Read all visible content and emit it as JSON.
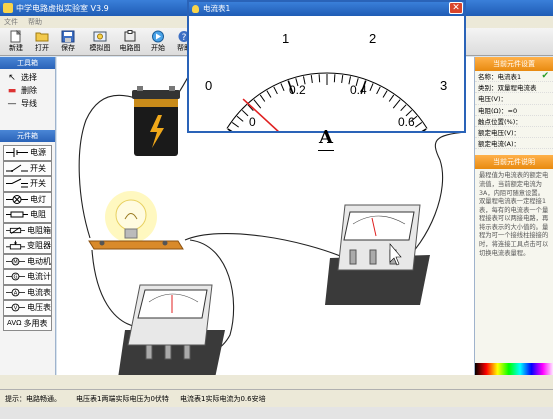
{
  "window": {
    "title": "中学电路虚拟实验室 V3.9"
  },
  "menu": [
    "文件",
    "帮助"
  ],
  "toolbar": [
    {
      "label": "新建",
      "icon": "new-icon"
    },
    {
      "label": "打开",
      "icon": "open-folder-icon"
    },
    {
      "label": "保存",
      "icon": "save-icon"
    },
    {
      "label": "模拟图",
      "icon": "simulation-icon"
    },
    {
      "label": "电路图",
      "icon": "circuit-diagram-icon"
    },
    {
      "label": "开始",
      "icon": "start-icon"
    },
    {
      "label": "帮助",
      "icon": "help-icon"
    }
  ],
  "toolbox": {
    "header": "工具箱",
    "tools": [
      {
        "label": "选择",
        "icon": "cursor-icon"
      },
      {
        "label": "删除",
        "icon": "eraser-icon"
      },
      {
        "label": "导线",
        "icon": "wire-icon"
      }
    ]
  },
  "parts": {
    "header": "元件箱",
    "items": [
      {
        "label": "电源",
        "icon": "battery-symbol-icon"
      },
      {
        "label": "开关",
        "icon": "switch-symbol-icon"
      },
      {
        "label": "开关",
        "icon": "switch-symbol-icon"
      },
      {
        "label": "电灯",
        "icon": "lamp-symbol-icon"
      },
      {
        "label": "电阻",
        "icon": "resistor-symbol-icon"
      },
      {
        "label": "电阻箱",
        "icon": "resistance-box-symbol-icon"
      },
      {
        "label": "变阻器",
        "icon": "rheostat-symbol-icon"
      },
      {
        "label": "电动机",
        "icon": "motor-symbol-icon"
      },
      {
        "label": "电流计",
        "icon": "galvanometer-symbol-icon"
      },
      {
        "label": "电流表",
        "icon": "ammeter-symbol-icon"
      },
      {
        "label": "电压表",
        "icon": "voltmeter-symbol-icon"
      },
      {
        "label": "多用表",
        "prefix": "AVΩ",
        "icon": "multimeter-symbol-icon"
      }
    ]
  },
  "properties": {
    "header": "当前元件设置",
    "rows": [
      "名称：电流表1",
      "类别：双量程电流表",
      "电压(V)：",
      "电阻(Ω)：≈0",
      "触点位置(%)：",
      "额定电压(V)：",
      "额定电流(A)："
    ]
  },
  "description": {
    "header": "当前元件说明",
    "text": "最程值为电流表的额定电流值，当前额定电流为3A，内阻可随意设置。双量程电流表一定程接1表，每有的电流表一个量程接表可以两接电路，再将示表示的大小值的。量程为可一个接线柱接接的时，将连接工具点击可以切换电流表量程。"
  },
  "status": {
    "hint": "提示：电路畅通。",
    "voltmeter": "电压表1两端实际电压为0伏特",
    "ammeter": "电流表1实际电流为0.6安培"
  },
  "popup": {
    "title": "电流表1",
    "top_labels": [
      "0",
      "1",
      "2",
      "3"
    ],
    "bottom_labels": [
      "0",
      "0.2",
      "0.4",
      "0.6"
    ],
    "unit": "A",
    "reading_fraction": 1.0
  },
  "colors": {
    "accent": "#2a63b8",
    "panel_header": "#e88a10",
    "needle": "#e02020"
  }
}
